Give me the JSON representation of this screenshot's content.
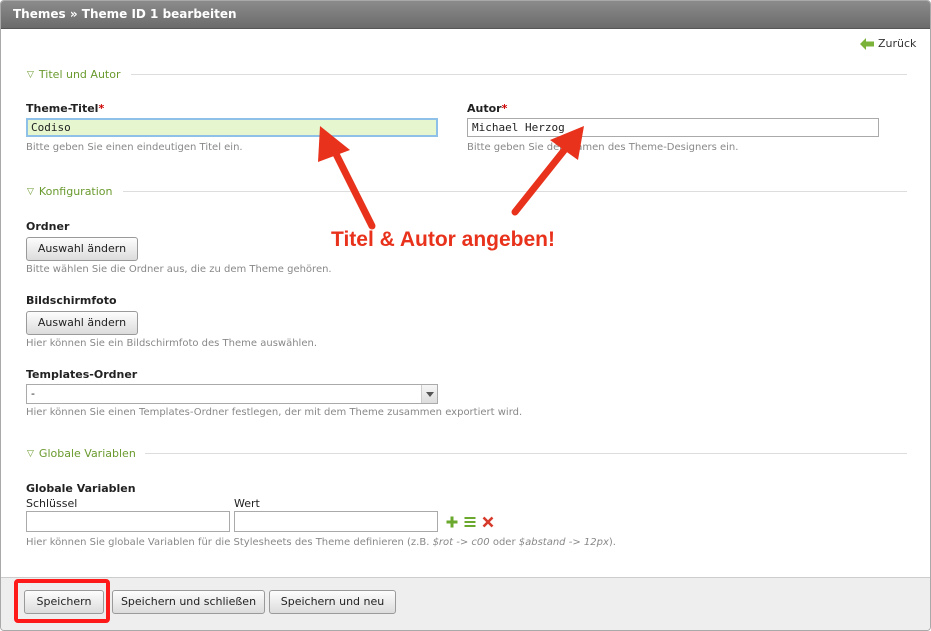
{
  "header": {
    "title": "Themes » Theme ID 1 bearbeiten"
  },
  "nav": {
    "back_label": "Zurück"
  },
  "section_title_author": {
    "legend": "Titel und Autor",
    "theme_title_label": "Theme-Titel",
    "theme_title_required": "*",
    "theme_title_value": "Codiso",
    "theme_title_hint": "Bitte geben Sie einen eindeutigen Titel ein.",
    "author_label": "Autor",
    "author_required": "*",
    "author_value": "Michael Herzog",
    "author_hint": "Bitte geben Sie den Namen des Theme-Designers ein."
  },
  "section_config": {
    "legend": "Konfiguration",
    "folder_label": "Ordner",
    "folder_button": "Auswahl ändern",
    "folder_hint": "Bitte wählen Sie die Ordner aus, die zu dem Theme gehören.",
    "screenshot_label": "Bildschirmfoto",
    "screenshot_button": "Auswahl ändern",
    "screenshot_hint": "Hier können Sie ein Bildschirmfoto des Theme auswählen.",
    "templates_label": "Templates-Ordner",
    "templates_value": "-",
    "templates_hint": "Hier können Sie einen Templates-Ordner festlegen, der mit dem Theme zusammen exportiert wird."
  },
  "section_vars": {
    "legend": "Globale Variablen",
    "label": "Globale Variablen",
    "key_label": "Schlüssel",
    "value_label": "Wert",
    "key_value": "",
    "value_value": "",
    "hint_prefix": "Hier können Sie globale Variablen für die Stylesheets des Theme definieren (z.B. ",
    "hint_ex1": "$rot -> c00",
    "hint_mid": " oder ",
    "hint_ex2": "$abstand -> 12px",
    "hint_suffix": ")."
  },
  "footer": {
    "save": "Speichern",
    "save_close": "Speichern und schließen",
    "save_new": "Speichern und neu"
  },
  "annotation": {
    "text": "Titel & Autor angeben!"
  },
  "colors": {
    "accent_green": "#6a9a2e",
    "required_red": "#cc0000",
    "annotation_red": "#e8321c",
    "highlight_box": "#ff1a1a",
    "focus_bg": "#e6f7cf"
  }
}
